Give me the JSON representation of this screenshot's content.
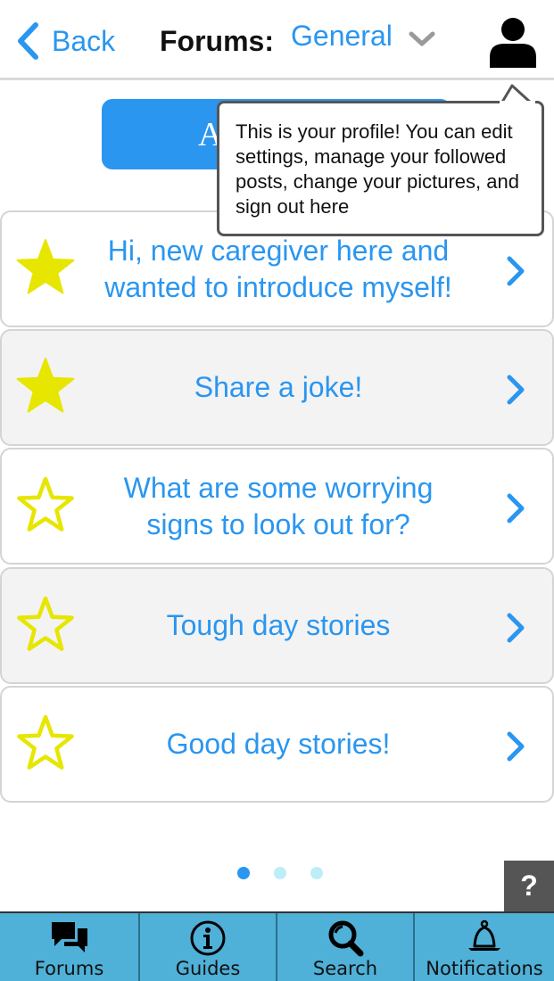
{
  "header": {
    "back_label": "Back",
    "forums_label": "Forums:",
    "forum_selected": "General"
  },
  "add_button_label": "A",
  "tooltip": {
    "text": "This is your profile! You can edit settings, manage your followed posts, change your pictures, and sign out here"
  },
  "topics": [
    {
      "title": "Hi, new caregiver here and wanted to introduce myself!",
      "starred": true
    },
    {
      "title": "Share a joke!",
      "starred": true
    },
    {
      "title": "What are some worrying signs to look out for?",
      "starred": false
    },
    {
      "title": "Tough day stories",
      "starred": false
    },
    {
      "title": "Good day stories!",
      "starred": false
    }
  ],
  "pager": {
    "pages": 3,
    "current_page": 1
  },
  "help_label": "?",
  "nav": [
    {
      "label": "Forums",
      "icon": "chat-icon",
      "active": true
    },
    {
      "label": "Guides",
      "icon": "info-icon",
      "active": false
    },
    {
      "label": "Search",
      "icon": "search-icon",
      "active": false
    },
    {
      "label": "Notifications",
      "icon": "bell-icon",
      "active": false
    }
  ],
  "colors": {
    "accent_blue": "#2a96f0",
    "star_yellow": "#e6e600",
    "nav_bg": "#4fb0d8",
    "nav_active_bg": "#2e8db8",
    "dot_active": "#2a96f0",
    "dot_inactive": "#bdeef7"
  }
}
